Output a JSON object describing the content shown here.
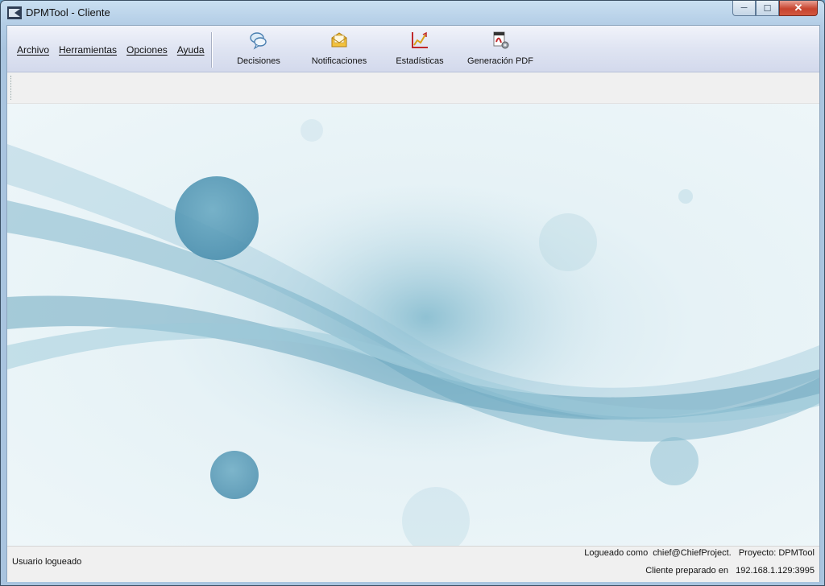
{
  "window": {
    "title": "DPMTool - Cliente"
  },
  "caption": {
    "minimize": "─",
    "maximize": "☐",
    "close": "✕"
  },
  "menu": {
    "items": [
      "Archivo",
      "Herramientas",
      "Opciones",
      "Ayuda"
    ]
  },
  "toolbar": {
    "items": [
      {
        "label": "Decisiones",
        "icon": "speech-bubbles-icon"
      },
      {
        "label": "Notificaciones",
        "icon": "envelope-icon"
      },
      {
        "label": "Estadísticas",
        "icon": "line-chart-icon"
      },
      {
        "label": "Generación PDF",
        "icon": "pdf-document-icon"
      }
    ]
  },
  "status": {
    "left": "Usuario logueado",
    "logged_as": "Logueado como  chief@ChiefProject.   Proyecto: DPMTool",
    "client_ready": "Cliente preparado en   192.168.1.129:3995"
  },
  "colors": {
    "wave": "#5fa3bd",
    "background": "#e8f3f7",
    "titlebar": "#b8d0e8",
    "close": "#c7442f"
  }
}
